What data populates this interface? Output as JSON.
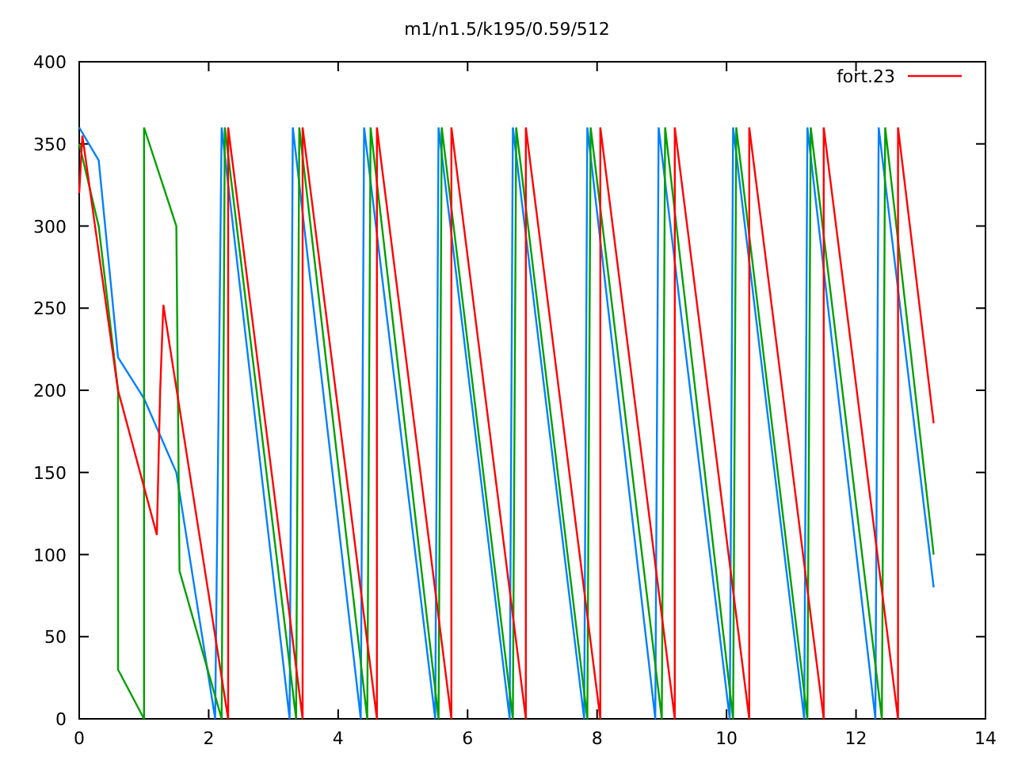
{
  "plot": {
    "chart_data": {
      "type": "line",
      "title": "m1/n1.5/k195/0.59/512",
      "xlim": [
        0,
        14
      ],
      "ylim": [
        0,
        400
      ],
      "xticks": [
        0,
        2,
        4,
        6,
        8,
        10,
        12,
        14
      ],
      "yticks": [
        0,
        50,
        100,
        150,
        200,
        250,
        300,
        350,
        400
      ],
      "series": [
        {
          "name": "fort.23",
          "color": "#ff0000",
          "x": [
            0,
            0.05,
            0.6,
            1.2,
            1.25,
            1.3,
            2.3,
            2.3,
            3.45,
            3.45,
            4.6,
            4.6,
            5.75,
            5.75,
            6.9,
            6.9,
            8.05,
            8.05,
            9.2,
            9.2,
            10.35,
            10.35,
            11.5,
            11.5,
            12.65,
            12.65,
            13.2
          ],
          "values": [
            320,
            355,
            200,
            112,
            200,
            252,
            0,
            360,
            0,
            360,
            0,
            360,
            0,
            360,
            0,
            360,
            0,
            360,
            0,
            360,
            0,
            360,
            0,
            360,
            0,
            360,
            180
          ]
        },
        {
          "color": "#00a000",
          "x": [
            0,
            0.3,
            0.6,
            0.6,
            1.0,
            1.0,
            1.5,
            1.55,
            2.2,
            2.25,
            3.35,
            3.4,
            4.45,
            4.5,
            5.55,
            5.6,
            6.7,
            6.75,
            7.85,
            7.9,
            9.0,
            9.05,
            10.1,
            10.15,
            11.25,
            11.3,
            12.4,
            12.45,
            13.2
          ],
          "values": [
            350,
            300,
            200,
            30,
            0,
            360,
            300,
            90,
            0,
            360,
            0,
            360,
            0,
            360,
            0,
            360,
            0,
            360,
            0,
            360,
            0,
            360,
            0,
            360,
            0,
            360,
            0,
            360,
            100
          ]
        },
        {
          "color": "#0080ff",
          "x": [
            0,
            0.3,
            0.6,
            1.0,
            1.5,
            2.1,
            2.2,
            3.25,
            3.3,
            4.35,
            4.4,
            5.5,
            5.55,
            6.65,
            6.7,
            7.8,
            7.85,
            8.9,
            8.95,
            10.05,
            10.1,
            11.2,
            11.25,
            12.3,
            12.35,
            13.2
          ],
          "values": [
            360,
            340,
            220,
            195,
            150,
            0,
            360,
            0,
            360,
            0,
            360,
            0,
            360,
            0,
            360,
            0,
            360,
            0,
            360,
            0,
            360,
            0,
            360,
            0,
            360,
            80
          ]
        }
      ]
    }
  }
}
